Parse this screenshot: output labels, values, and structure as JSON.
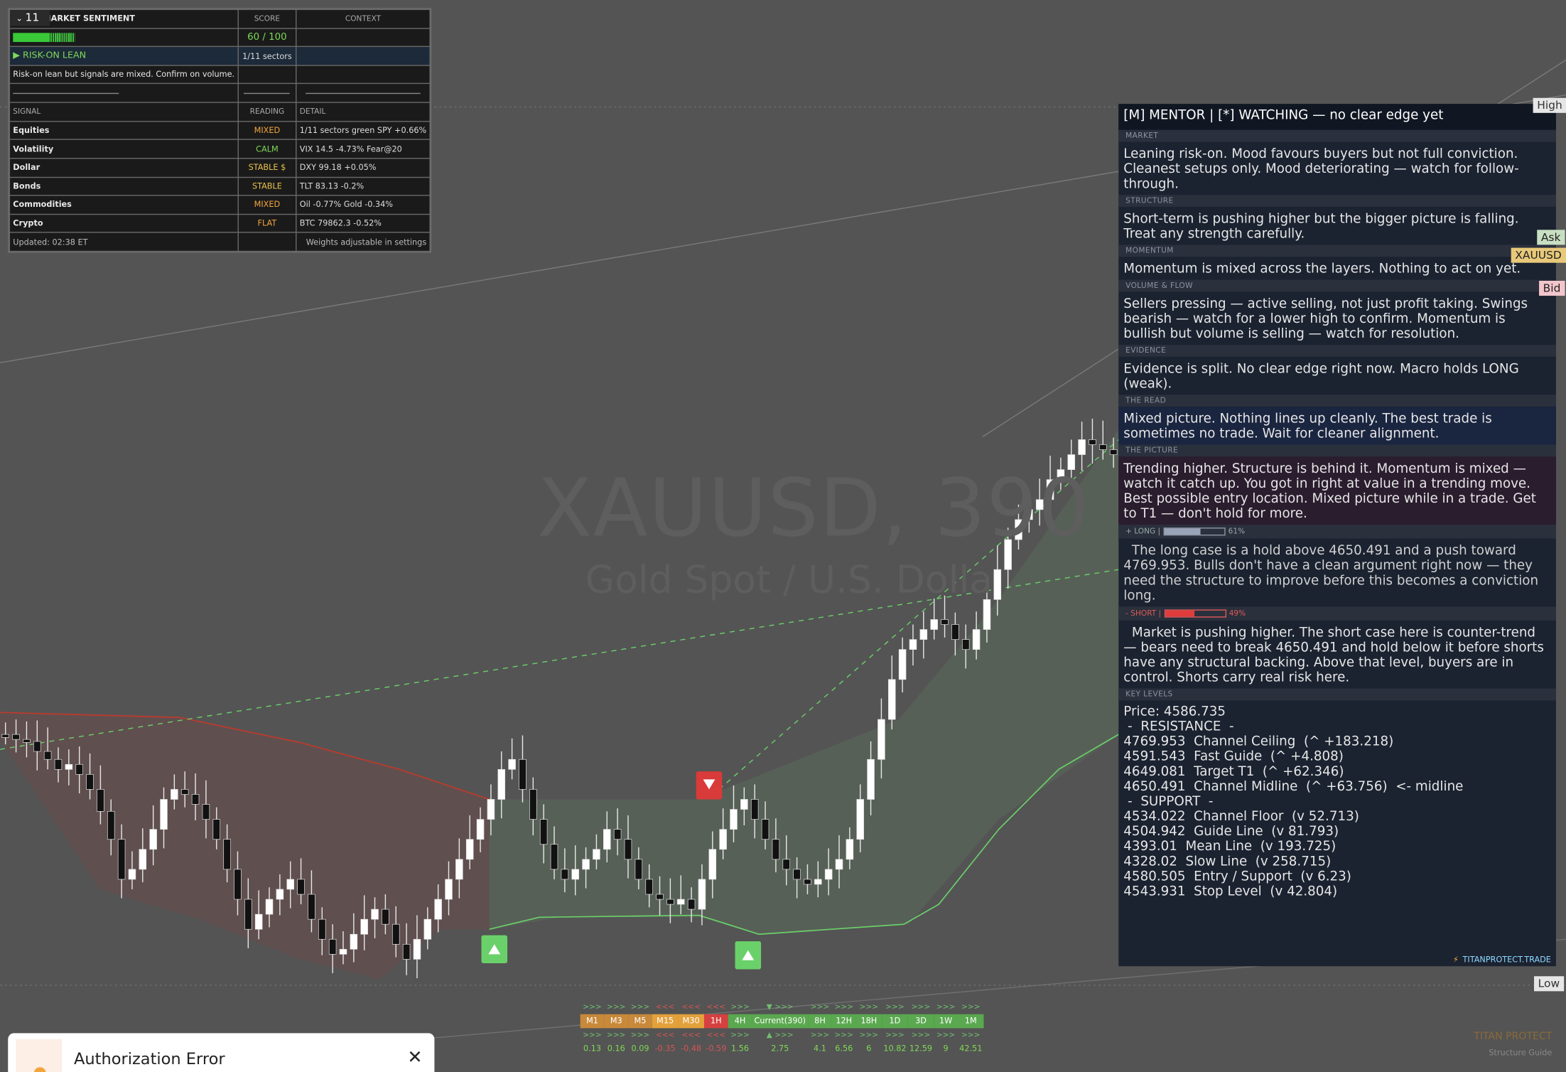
{
  "chip": {
    "label": "11"
  },
  "watermark": {
    "symbol": "XAUUSD, 390",
    "name": "Gold Spot / U.S. Dolla"
  },
  "sentiment": {
    "header": {
      "col1": "MARKET SENTIMENT",
      "col2": "SCORE",
      "col3": "CONTEXT"
    },
    "score": {
      "value": "60 / 100",
      "fill": 0.6
    },
    "lean": {
      "label": "▶ RISK-ON LEAN",
      "sectors": "1/11 sectors"
    },
    "note": "Risk-on lean but signals are mixed. Confirm on volume.",
    "signals_header": {
      "col1": "SIGNAL",
      "col2": "READING",
      "col3": "DETAIL"
    },
    "rows": [
      {
        "signal": "Equities",
        "reading": "MIXED",
        "detail": "1/11 sectors green  SPY +0.66%",
        "color": "#f3a53d"
      },
      {
        "signal": "Volatility",
        "reading": "CALM",
        "detail": "VIX 14.5  -4.73%  Fear@20",
        "color": "#7ed957"
      },
      {
        "signal": "Dollar",
        "reading": "STABLE $",
        "detail": "DXY 99.18  +0.05%",
        "color": "#e8c24a"
      },
      {
        "signal": "Bonds",
        "reading": "STABLE",
        "detail": "TLT 83.13  -0.2%",
        "color": "#e8c24a"
      },
      {
        "signal": "Commodities",
        "reading": "MIXED",
        "detail": "Oil -0.77%  Gold -0.34%",
        "color": "#f3a53d"
      },
      {
        "signal": "Crypto",
        "reading": "FLAT",
        "detail": "BTC 79862.3  -0.52%",
        "color": "#f3a53d"
      }
    ],
    "footer": {
      "updated": "Updated: 02:38 ET",
      "weights": "Weights adjustable in settings"
    }
  },
  "mentor": {
    "title": "[M]  MENTOR  |  [*]  WATCHING  —  no clear edge yet",
    "sections": [
      {
        "label": "MARKET",
        "text": "Leaning risk-on. Mood favours buyers but not full conviction. Cleanest setups only. Mood deteriorating — watch for follow-through."
      },
      {
        "label": "STRUCTURE",
        "text": "Short-term is pushing higher but the bigger picture is falling. Treat any strength carefully."
      },
      {
        "label": "MOMENTUM",
        "text": "Momentum is mixed across the layers. Nothing to act on yet."
      },
      {
        "label": "VOLUME & FLOW",
        "text": "Sellers pressing — active selling, not just profit taking. Swings bearish — watch for a lower high to confirm. Momentum is bullish but volume is selling — watch for resolution."
      },
      {
        "label": "EVIDENCE",
        "text": "Evidence is split. No clear edge right now. Macro holds LONG (weak)."
      },
      {
        "label": "THE READ",
        "text": "Mixed picture. Nothing lines up cleanly. The best trade is sometimes no trade. Wait for cleaner alignment."
      },
      {
        "label": "THE PICTURE",
        "text": "Trending higher. Structure is behind it. Momentum is mixed — watch it catch up. You got in right at value in a trending move. Best possible entry location. Mixed picture while in a trade. Get to T1 — don't hold for more."
      }
    ],
    "long": {
      "label": "+ LONG  |",
      "pct": "61%",
      "fill": 0.61,
      "text": "The long case is a hold above 4650.491 and a push toward 4769.953. Bulls don't have a clean argument right now — they need the structure to improve before this becomes a conviction long."
    },
    "short": {
      "label": "- SHORT  |",
      "pct": "49%",
      "fill": 0.49,
      "text": "Market is pushing higher. The short case here is counter-trend — bears need to break 4650.491 and hold below it before shorts have any structural backing. Above that level, buyers are in control. Shorts carry real risk here."
    },
    "key_levels_label": "KEY LEVELS",
    "levels": [
      "Price: 4586.735",
      " -  RESISTANCE  -",
      "4769.953  Channel Ceiling  (^ +183.218)",
      "4591.543  Fast Guide  (^ +4.808)",
      "4649.081  Target T1  (^ +62.346)",
      "4650.491  Channel Midline  (^ +63.756)  <- midline",
      " -  SUPPORT  -",
      "4534.022  Channel Floor  (v 52.713)",
      "4504.942  Guide Line  (v 81.793)",
      "4393.01  Mean Line  (v 193.725)",
      "4328.02  Slow Line  (v 258.715)",
      "4580.505  Entry / Support  (v 6.23)",
      "4543.931  Stop Level  (v 42.804)"
    ],
    "footer_icon": "⚡",
    "footer": "TITANPROTECT.TRADE"
  },
  "right_labels": {
    "high": "High",
    "ask": "Ask",
    "symbol": "XAUUSD",
    "bid": "Bid",
    "low": "Low"
  },
  "timeframes": {
    "labels": [
      "M1",
      "M3",
      "M5",
      "M15",
      "M30",
      "1H",
      "4H",
      "Current(390)",
      "8H",
      "12H",
      "18H",
      "1D",
      "3D",
      "1W",
      "1M"
    ],
    "colors": [
      "#c8893a",
      "#c8893a",
      "#c8893a",
      "#e3a13b",
      "#e3a13b",
      "#d64040",
      "#5aa84f",
      "#5aa84f",
      "#5aa84f",
      "#5aa84f",
      "#5aa84f",
      "#5aa84f",
      "#5aa84f",
      "#5aa84f",
      "#5aa84f"
    ],
    "top_arrows": [
      ">>>",
      ">>>",
      ">>>",
      "<<<",
      "<<<",
      "<<<",
      ">>>",
      "▼ >>>",
      ">>>",
      ">>>",
      ">>>",
      ">>>",
      ">>>",
      ">>>",
      ">>>"
    ],
    "bottom_arrows": [
      ">>>",
      ">>>",
      ">>>",
      "<<<",
      "<<<",
      "<<<",
      ">>>",
      "▲ >>>",
      ">>>",
      ">>>",
      ">>>",
      ">>>",
      ">>>",
      ">>>",
      ">>>"
    ],
    "values": [
      "0.13",
      "0.16",
      "0.09",
      "-0.35",
      "-0.48",
      "-0.59",
      "1.56",
      "2.75",
      "4.1",
      "6.56",
      "6",
      "10.82",
      "12.59",
      "9",
      "42.51"
    ]
  },
  "auth": {
    "title": "Authorization Error",
    "close": "✕"
  },
  "brand": {
    "name": "TITAN PROTECT",
    "sub": "Structure Guide"
  }
}
